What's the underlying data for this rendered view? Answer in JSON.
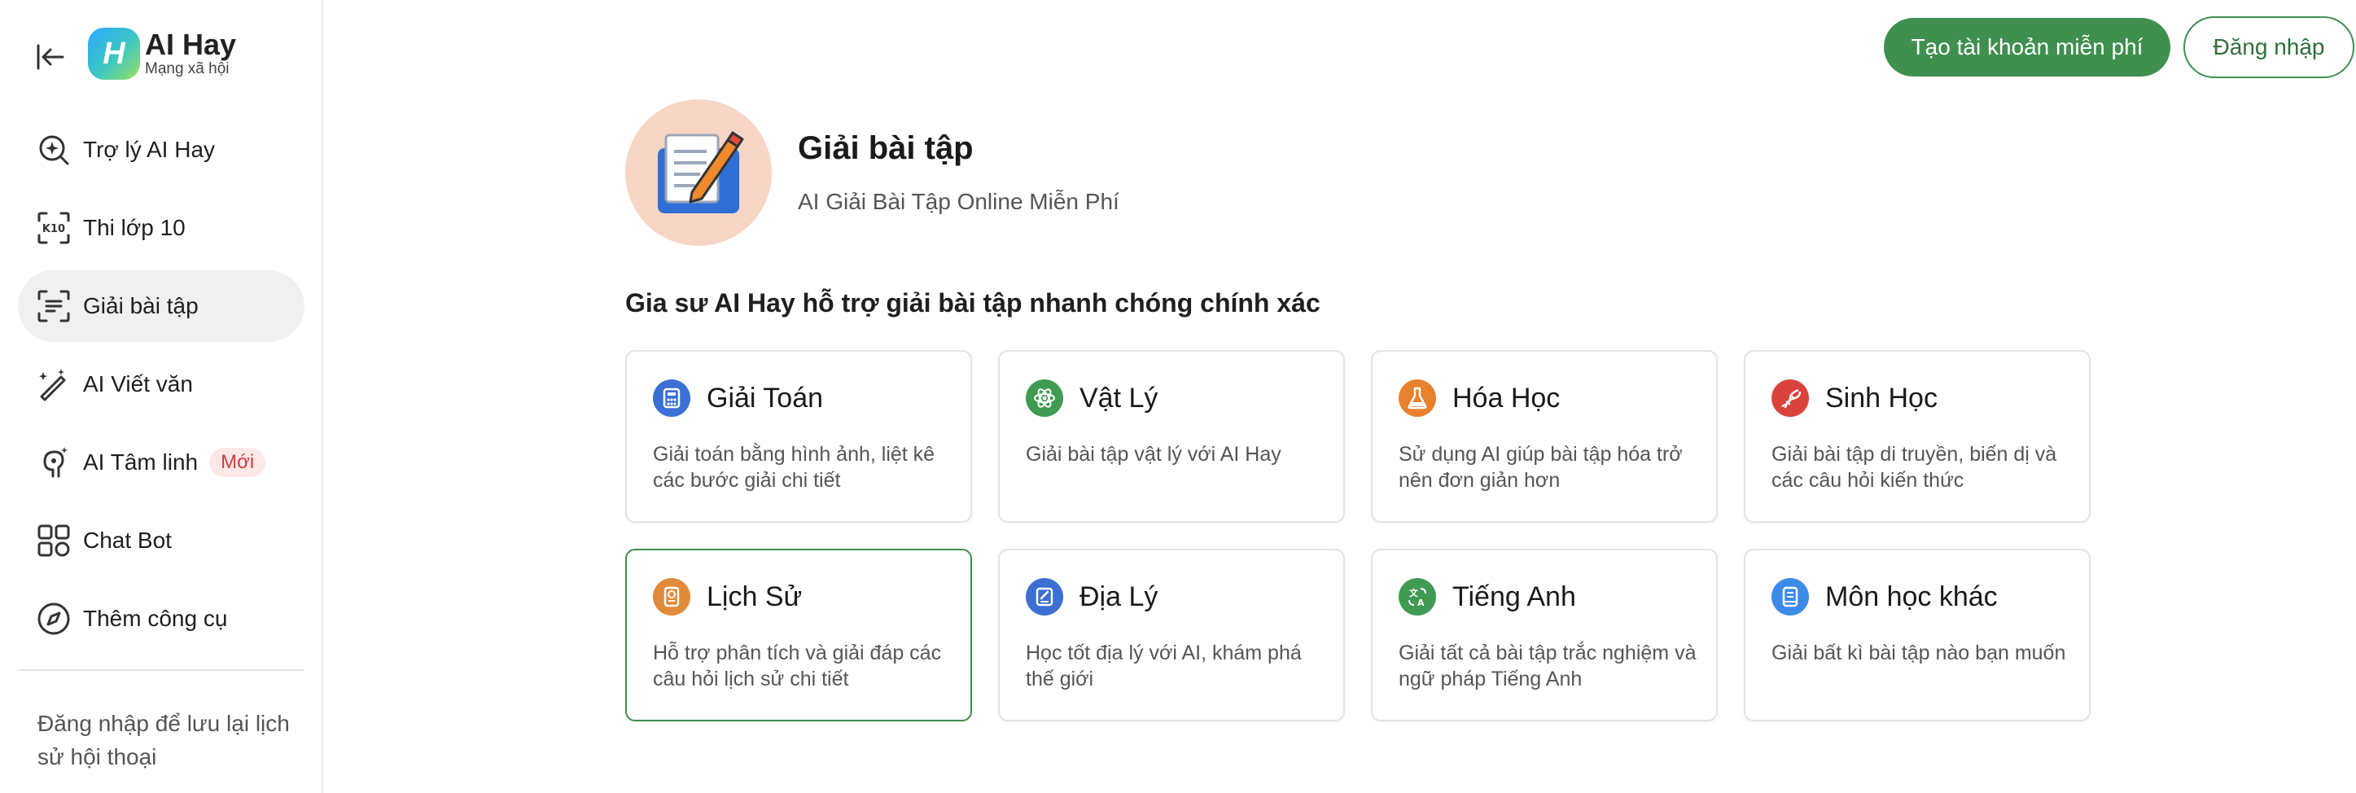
{
  "brand": {
    "title": "AI Hay",
    "subtitle": "Mạng xã hội",
    "mark": "H"
  },
  "sidebar": {
    "items": [
      {
        "label": "Trợ lý AI Hay",
        "icon": "ai-search-icon"
      },
      {
        "label": "Thi lớp 10",
        "icon": "k10-scan-icon"
      },
      {
        "label": "Giải bài tập",
        "icon": "scan-text-icon",
        "active": true
      },
      {
        "label": "AI Viết văn",
        "icon": "magic-pen-icon"
      },
      {
        "label": "AI Tâm linh",
        "icon": "spirit-icon",
        "badge": "Mới"
      },
      {
        "label": "Chat Bot",
        "icon": "grid-apps-icon"
      },
      {
        "label": "Thêm công cụ",
        "icon": "compass-icon"
      }
    ],
    "login_hint": "Đăng nhập để lưu lại lịch sử hội thoại"
  },
  "header": {
    "signup_label": "Tạo tài khoản miễn phí",
    "login_label": "Đăng nhập"
  },
  "hero": {
    "title": "Giải bài tập",
    "subtitle": "AI Giải Bài Tập Online Miễn Phí",
    "icon": "homework-pencil-icon"
  },
  "section_heading": "Gia sư AI Hay hỗ trợ giải bài tập nhanh chóng chính xác",
  "subjects": [
    {
      "title": "Giải Toán",
      "desc": "Giải toán bằng hình ảnh, liệt kê các bước giải chi tiết",
      "icon": "calculator-icon",
      "color": "#3b6fd4"
    },
    {
      "title": "Vật Lý",
      "desc": "Giải bài tập vật lý với AI Hay",
      "icon": "atom-icon",
      "color": "#3f9a52"
    },
    {
      "title": "Hóa Học",
      "desc": "Sử dụng AI giúp bài tập hóa trở nên đơn giản hơn",
      "icon": "flask-icon",
      "color": "#e8812d"
    },
    {
      "title": "Sinh Học",
      "desc": "Giải bài tập di truyền, biến dị và các câu hỏi kiến thức",
      "icon": "dna-icon",
      "color": "#d9433b"
    },
    {
      "title": "Lịch Sử",
      "desc": "Hỗ trợ phân tích và giải đáp các câu hỏi lịch sử chi tiết",
      "icon": "scroll-icon",
      "color": "#e08a3a"
    },
    {
      "title": "Địa Lý",
      "desc": "Học tốt địa lý với AI, khám phá thế giới",
      "icon": "map-icon",
      "color": "#3b6fd4"
    },
    {
      "title": "Tiếng Anh",
      "desc": "Giải tất cả bài tập trắc nghiệm và ngữ pháp Tiếng Anh",
      "icon": "translate-icon",
      "color": "#3f9a52"
    },
    {
      "title": "Môn học khác",
      "desc": "Giải bất kì bài tập nào bạn muốn",
      "icon": "book-icon",
      "color": "#3d8be8"
    }
  ]
}
